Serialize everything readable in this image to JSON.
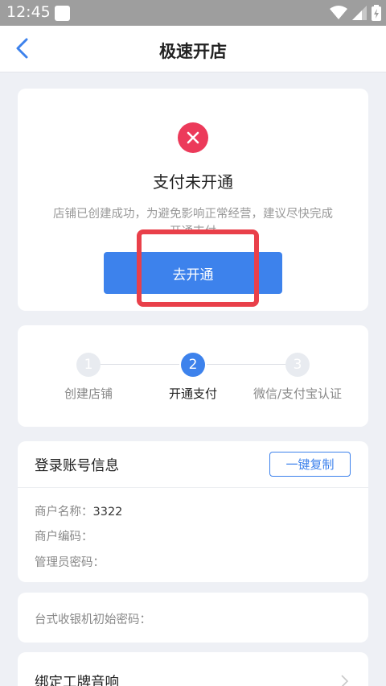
{
  "status_bar": {
    "time": "12:45"
  },
  "header": {
    "title": "极速开店"
  },
  "payment_status": {
    "title": "支付未开通",
    "description": "店铺已创建成功，为避免影响正常经营，建议尽快完成开通支付",
    "button_label": "去开通",
    "error_color": "#ec3a5a"
  },
  "steps": [
    {
      "number": "1",
      "label": "创建店铺",
      "state": "inactive"
    },
    {
      "number": "2",
      "label": "开通支付",
      "state": "active"
    },
    {
      "number": "3",
      "label": "微信/支付宝认证",
      "state": "inactive"
    }
  ],
  "account": {
    "title": "登录账号信息",
    "copy_label": "一键复制",
    "merchant_name_label": "商户名称：",
    "merchant_name_value": "3322",
    "merchant_code_label": "商户编码：",
    "merchant_code_value": "",
    "admin_password_label": "管理员密码：",
    "admin_password_value": ""
  },
  "pos": {
    "label": "台式收银机初始密码："
  },
  "bind_speaker": {
    "label": "绑定工牌音响"
  },
  "colors": {
    "accent": "#3d82ec",
    "highlight": "#e9404a"
  }
}
